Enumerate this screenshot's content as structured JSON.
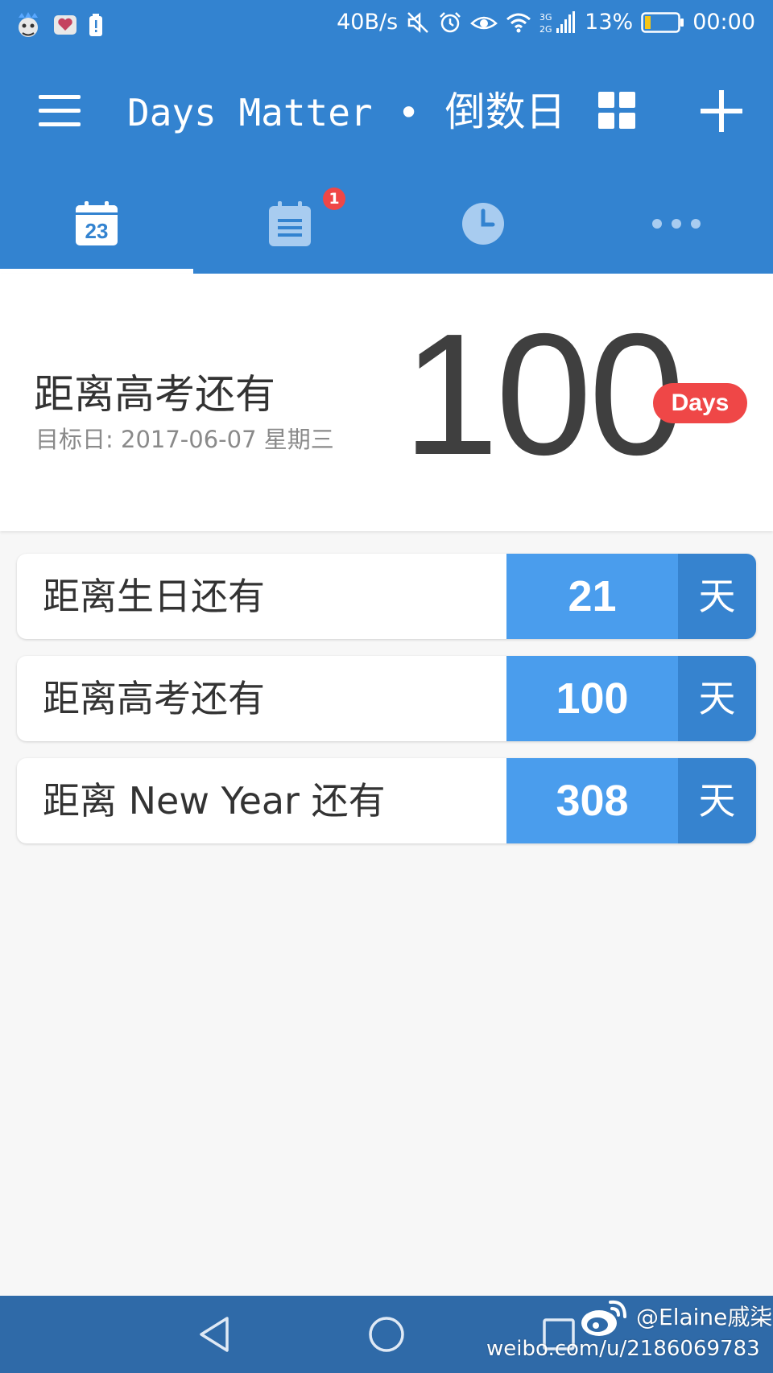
{
  "status_bar": {
    "speed": "40B/s",
    "network": "3G 2G",
    "battery": "13%",
    "time": "00:00",
    "icons": [
      "notification-app-icon",
      "heart-app-icon",
      "battery-alert-icon",
      "mute-icon",
      "alarm-icon",
      "eye-icon",
      "wifi-icon",
      "cell-signal-icon",
      "battery-icon"
    ]
  },
  "toolbar": {
    "title_en": "Days Matter",
    "separator": "•",
    "title_cn": "倒数日",
    "icons": [
      "menu-icon",
      "grid-view-icon",
      "add-icon"
    ]
  },
  "tabs": [
    {
      "icon": "calendar-day-icon",
      "label": "23",
      "active": true
    },
    {
      "icon": "notepad-icon",
      "badge": "1",
      "active": false
    },
    {
      "icon": "clock-icon",
      "active": false
    },
    {
      "icon": "more-icon",
      "active": false
    }
  ],
  "hero": {
    "title": "距离高考还有",
    "subtitle": "目标日: 2017-06-07 星期三",
    "count": "100",
    "unit": "Days"
  },
  "events": [
    {
      "title": "距离生日还有",
      "count": "21",
      "unit": "天"
    },
    {
      "title": "距离高考还有",
      "count": "100",
      "unit": "天"
    },
    {
      "title": "距离 New Year 还有",
      "count": "308",
      "unit": "天"
    }
  ],
  "nav": {
    "icons": [
      "back-icon",
      "home-icon",
      "recents-icon"
    ]
  },
  "watermark": {
    "user": "@Elaine戚柒",
    "url": "weibo.com/u/2186069783",
    "icon": "weibo-logo-icon"
  },
  "colors": {
    "primary": "#3383d0",
    "accent": "#ef4747",
    "count_cell": "#4a9ded",
    "unit_cell": "#3683cf",
    "nav_bar": "#2f6aa8"
  }
}
